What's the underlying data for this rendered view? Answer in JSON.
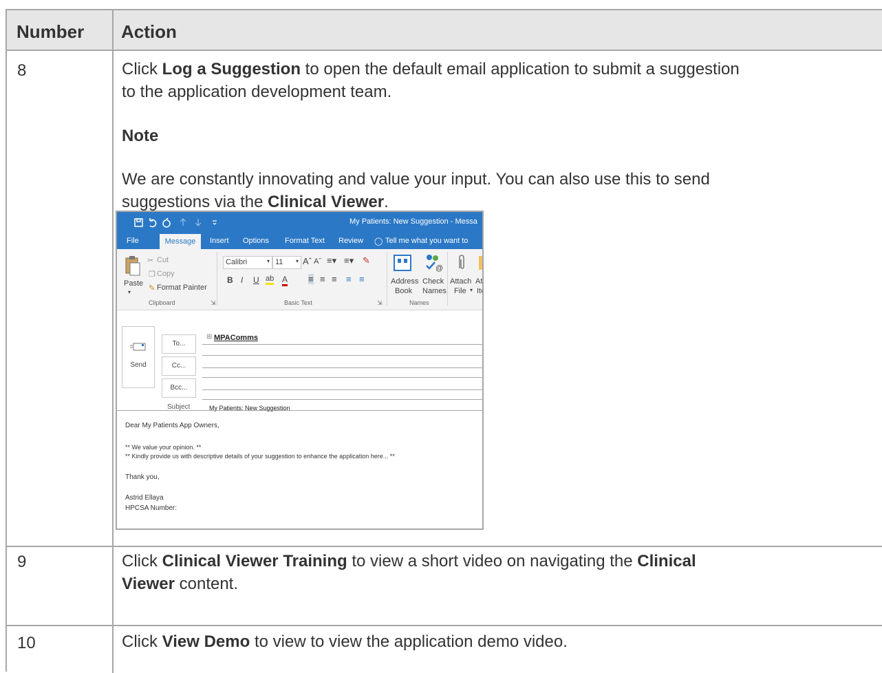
{
  "table": {
    "headers": {
      "number": "Number",
      "action": "Action"
    },
    "rows": [
      {
        "number": "8",
        "line1": {
          "pre": "Click ",
          "bold": "Log a Suggestion",
          "post": " to open the default email application to submit a suggestion"
        },
        "line2": "to the application development team.",
        "note_heading": "Note",
        "note_line1": "We are constantly innovating and value your input. You can also use this to send",
        "note_line2": {
          "pre": "suggestions via the ",
          "bold": "Clinical Viewer",
          "post": "."
        }
      },
      {
        "number": "9",
        "line1": {
          "pre": "Click ",
          "bold": "Clinical Viewer Training",
          "post": " to view a short video on navigating the ",
          "bold2": "Clinical"
        },
        "line2": {
          "bold": "Viewer",
          "post": " content."
        }
      },
      {
        "number": "10",
        "line1": {
          "pre": "Click ",
          "bold": "View Demo",
          "post": " to view to view the application demo video."
        }
      }
    ]
  },
  "outlook": {
    "window_title": "My Patients: New Suggestion - Messa",
    "qat_icons": [
      "save-icon",
      "undo-icon",
      "redo-icon",
      "up-arrow-icon",
      "down-arrow-icon",
      "customize-icon"
    ],
    "tabs": [
      "File",
      "Message",
      "Insert",
      "Options",
      "Format Text",
      "Review"
    ],
    "tell_me": "Tell me what you want to",
    "ribbon": {
      "paste": "Paste",
      "cut": "Cut",
      "copy": "Copy",
      "format_painter": "Format Painter",
      "clipboard_group": "Clipboard",
      "font_name": "Calibri",
      "font_size": "11",
      "basic_text_group": "Basic Text",
      "address_book_1": "Address",
      "address_book_2": "Book",
      "check_names_1": "Check",
      "check_names_2": "Names",
      "names_group": "Names",
      "attach_1": "Attach",
      "attach_2": "File",
      "attach_item_1": "At",
      "attach_item_2": "Ite"
    },
    "send": "Send",
    "to_button": "To...",
    "cc_button": "Cc...",
    "bcc_button": "Bcc...",
    "to_value": "MPAComms",
    "subject_label": "Subject",
    "subject_value": "My Patients: New Suggestion",
    "body_lines": [
      "Dear My Patients App Owners,",
      "** We value your opinion. **",
      "** Kindly provide us with descriptive details of your suggestion to enhance the application here... **",
      "Thank you,",
      "Astrid Ellaya",
      "HPCSA Number:"
    ],
    "colors": {
      "title_bar": "#2b78c6",
      "ribbon": "#f3f3f3"
    }
  }
}
